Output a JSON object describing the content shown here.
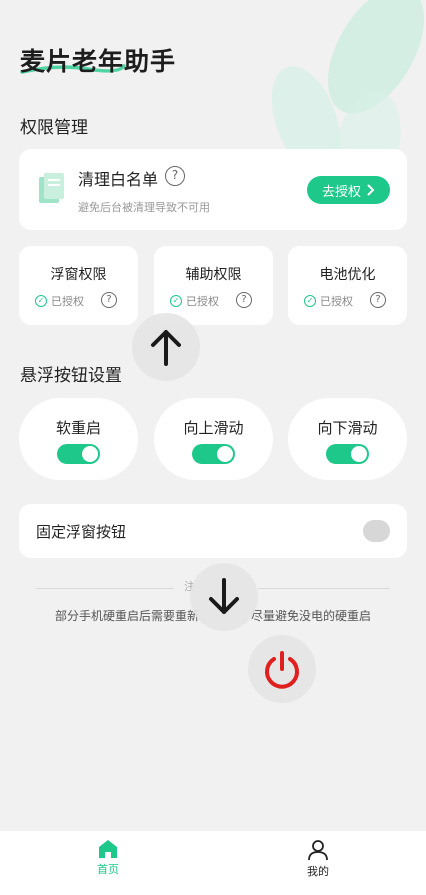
{
  "app": {
    "title": "麦片老年助手"
  },
  "permissions": {
    "section_title": "权限管理",
    "whitelist": {
      "title": "清理白名单",
      "help": "?",
      "desc": "避免后台被清理导致不可用",
      "button_label": "去授权"
    },
    "items": [
      {
        "name": "浮窗权限",
        "status": "已授权",
        "help": "?"
      },
      {
        "name": "辅助权限",
        "status": "已授权",
        "help": "?"
      },
      {
        "name": "电池优化",
        "status": "已授权",
        "help": "?"
      }
    ]
  },
  "float_settings": {
    "section_title": "悬浮按钮设置",
    "buttons": [
      {
        "name": "软重启",
        "enabled": true
      },
      {
        "name": "向上滑动",
        "enabled": true
      },
      {
        "name": "向下滑动",
        "enabled": true
      }
    ],
    "fixed": {
      "label": "固定浮窗按钮",
      "enabled": false
    }
  },
  "note": {
    "text_left": "部分手机硬重启后需要重新",
    "text_right": "尽量避免没电的硬重启",
    "partial_glyph": "注"
  },
  "tabs": [
    {
      "label": "首页",
      "active": true
    },
    {
      "label": "我的",
      "active": false
    }
  ],
  "colors": {
    "accent": "#1ec88a",
    "power": "#e0201e"
  },
  "icons": {
    "float_up": "arrow-up-icon",
    "float_down": "arrow-down-icon",
    "float_power": "power-icon"
  }
}
